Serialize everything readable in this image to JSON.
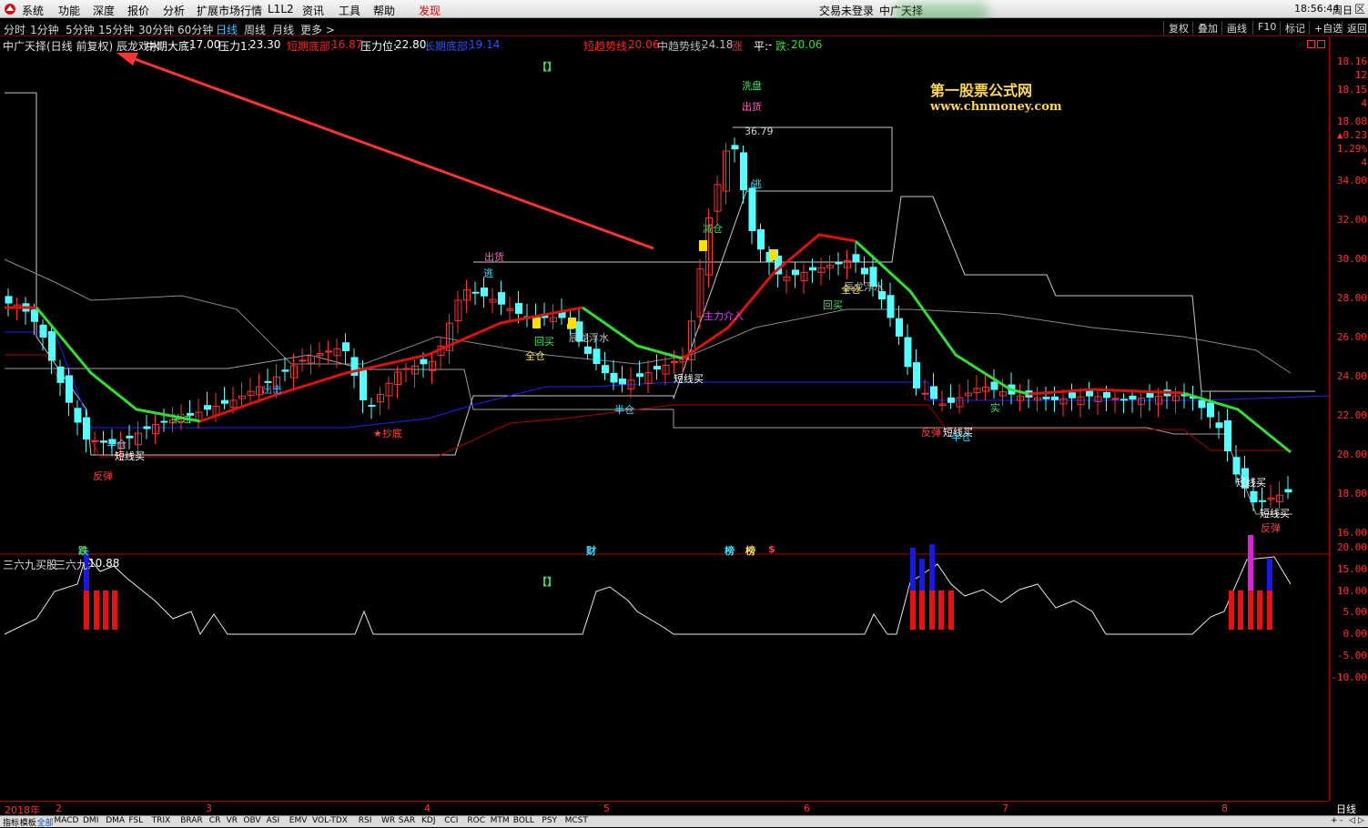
{
  "menubar": {
    "items": [
      "系统",
      "功能",
      "深度",
      "报价",
      "分析",
      "扩展市场行情",
      "L1L2",
      "资讯",
      "工具",
      "帮助",
      "发现"
    ],
    "login_status": "交易未登录",
    "app_name": "中广天择",
    "clock": "18:56:44",
    "weekday": "周日",
    "window_buttons": [
      "_",
      "回",
      "区"
    ]
  },
  "tabbar": {
    "tabs": [
      "分时",
      "1分钟",
      "5分钟",
      "15分钟",
      "30分钟",
      "60分钟",
      "日线",
      "周线",
      "月线",
      "更多 >"
    ],
    "active": "日线",
    "right_buttons": [
      "复权",
      "叠加",
      "画线",
      "F10",
      "标记",
      "+自选",
      "返回"
    ]
  },
  "info": {
    "stock": "中广天择(日线 前复权) 辰龙戏水",
    "mid_bottom_label": "中期大底:",
    "mid_bottom": "17.00",
    "press1_label": "压力1:",
    "press1": "23.30",
    "short_bottom_label": "短期底部:",
    "short_bottom": "16.87",
    "press_label": "压力位:",
    "press": "22.80",
    "long_bottom_label": "长期底部:",
    "long_bottom": "19.14",
    "short_trend_label": "短趋势线:",
    "short_trend": "20.06",
    "mid_trend_label": "中趋势线:",
    "mid_trend": "24.18",
    "up_label": "涨",
    "flat_label": "平:",
    "flat": "-",
    "down_label": "跌:",
    "down": "20.06"
  },
  "price_panel_right": [
    "18.16",
    "12",
    "18.15",
    "4",
    "18.08",
    "▲0.23",
    "1.29%",
    "4"
  ],
  "price_axis": [
    "34.00",
    "32.00",
    "30.00",
    "28.00",
    "26.00",
    "24.00",
    "22.00",
    "20.00",
    "18.00",
    "16.00"
  ],
  "watermark": {
    "title": "第一股票公式网",
    "url": "www.chnmoney.com"
  },
  "price_marker": "36.79",
  "signals": [
    {
      "text": "洗盘",
      "color": "#40e060"
    },
    {
      "text": "出货",
      "color": "#ff60c0"
    },
    {
      "text": "出货",
      "color": "#ff60c0"
    },
    {
      "text": "逃",
      "color": "#40e0ff"
    },
    {
      "text": "逃",
      "color": "#40e0ff"
    },
    {
      "text": "减仓",
      "color": "#40e060"
    },
    {
      "text": "主力介入",
      "color": "#e040ff"
    },
    {
      "text": "回买",
      "color": "#40e060"
    },
    {
      "text": "全仓",
      "color": "#ffe060"
    },
    {
      "text": "回买",
      "color": "#40e060"
    },
    {
      "text": "辰龙浮水",
      "color": "#c0c0c0"
    },
    {
      "text": "辰龙浮水",
      "color": "#c0c0c0"
    },
    {
      "text": "全仓",
      "color": "#ffe060"
    },
    {
      "text": "半仓",
      "color": "#40e0ff"
    },
    {
      "text": "短线买",
      "color": "#ffffff"
    },
    {
      "text": "出击",
      "color": "#40a0ff"
    },
    {
      "text": "关注",
      "color": "#40e060"
    },
    {
      "text": "★抄底",
      "color": "#ff4040"
    },
    {
      "text": "半仓",
      "color": "#40e0ff"
    },
    {
      "text": "短线买",
      "color": "#ffffff"
    },
    {
      "text": "反弹",
      "color": "#ff4040"
    },
    {
      "text": "反弹",
      "color": "#ff4040"
    },
    {
      "text": "短线买",
      "color": "#ffffff"
    },
    {
      "text": "半仓",
      "color": "#40e0ff"
    },
    {
      "text": "实",
      "color": "#40e060"
    },
    {
      "text": "短线买",
      "color": "#ffffff"
    },
    {
      "text": "短线买",
      "color": "#ffffff"
    },
    {
      "text": "反弹",
      "color": "#ff4040"
    }
  ],
  "event_marks": [
    {
      "text": "跌",
      "color": "#40e060"
    },
    {
      "text": "财",
      "color": "#40e0ff"
    },
    {
      "text": "榜",
      "color": "#40e0ff"
    },
    {
      "text": "榜",
      "color": "#ffe060"
    },
    {
      "text": "$",
      "color": "#ff4040"
    },
    {
      "text": "【】",
      "color": "#40e060"
    },
    {
      "text": "【】",
      "color": "#40e060"
    }
  ],
  "indicator": {
    "title": "三六九买股",
    "value_label": "三六九:",
    "value": "10.88",
    "axis": [
      "20.00",
      "15.00",
      "10.00",
      "5.00",
      "0.00",
      "-5.00",
      "-10.00"
    ]
  },
  "dates": {
    "year": "2018年",
    "months": [
      "2",
      "3",
      "4",
      "5",
      "6",
      "7",
      "8"
    ],
    "period": "日线"
  },
  "bottom_tabs": [
    "指标",
    "模板",
    "全部",
    "MACD",
    "DMI",
    "DMA",
    "FSL",
    "TRIX",
    "BRAR",
    "CR",
    "VR",
    "OBV",
    "ASI",
    "EMV",
    "VOL-TDX",
    "RSI",
    "WR",
    "SAR",
    "KDJ",
    "CCI",
    "ROC",
    "MTM",
    "BOLL",
    "PSY",
    "MCST"
  ],
  "bottom_active": "全部",
  "bottom_nav": [
    "+",
    "-",
    "◁",
    "▷"
  ],
  "colors": {
    "up": "#ff3030",
    "down": "#54ffff",
    "bg": "#000000",
    "ma_up": "#e01010",
    "ma_down": "#30e030"
  }
}
